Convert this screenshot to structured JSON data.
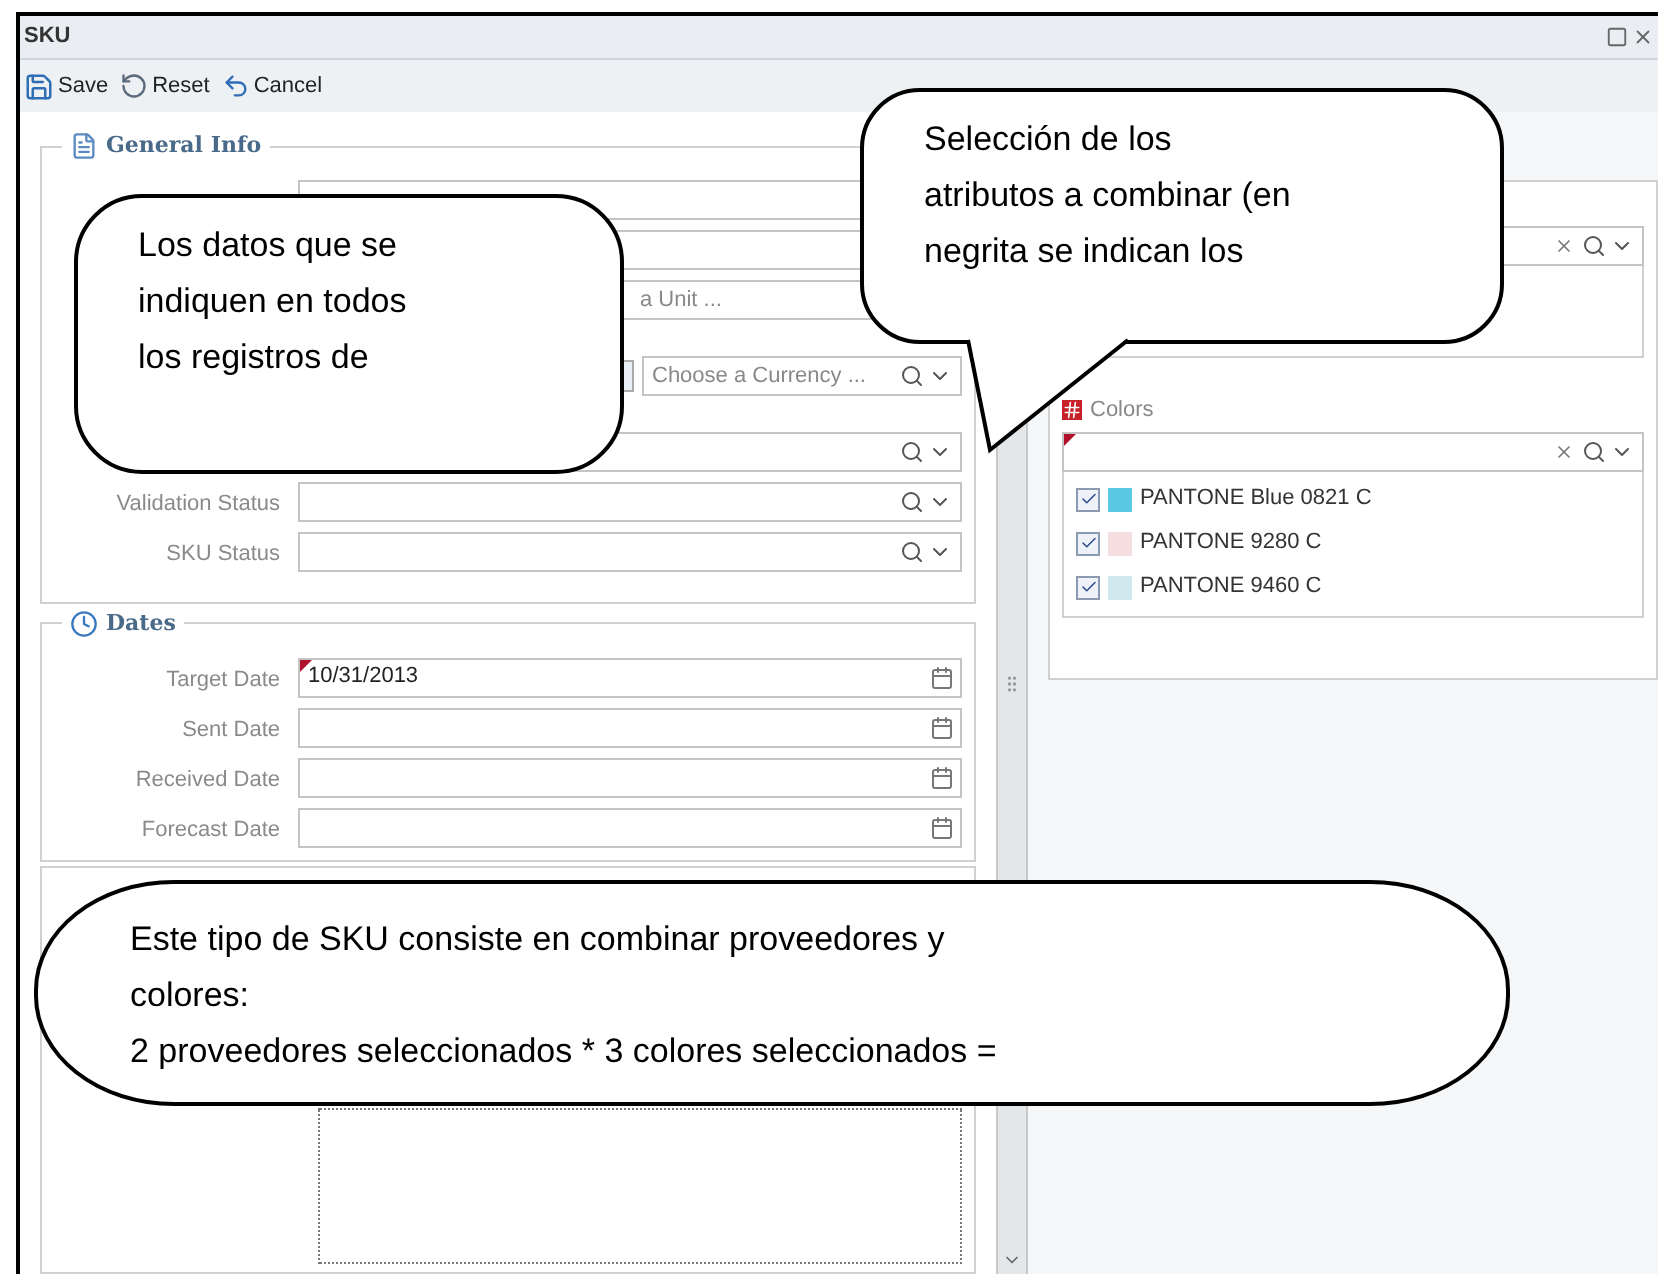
{
  "window": {
    "title": "SKU"
  },
  "toolbar": [
    {
      "kind": "save",
      "label": "Save"
    },
    {
      "kind": "reset",
      "label": "Reset"
    },
    {
      "kind": "cancel",
      "label": "Cancel"
    }
  ],
  "general_info": {
    "title": "General Info",
    "fields": [
      {
        "kind": "text"
      },
      {
        "kind": "text"
      },
      {
        "kind": "text",
        "placeholder": "a Unit ..."
      },
      {
        "kind": "currency",
        "placeholder": "Choose a Currency ..."
      },
      {
        "kind": "combo"
      },
      {
        "kind": "combo",
        "label": "Validation Status"
      },
      {
        "kind": "combo",
        "label": "SKU Status"
      }
    ]
  },
  "dates": {
    "title": "Dates",
    "fields": [
      {
        "label": "Target Date",
        "value": "10/31/2013",
        "required": true
      },
      {
        "label": "Sent Date",
        "required": false
      },
      {
        "label": "Received Date",
        "required": false
      },
      {
        "label": "Forecast Date",
        "required": false
      }
    ]
  },
  "attributes": {
    "colors": {
      "title": "Colors",
      "required": true,
      "items": [
        {
          "name": "PANTONE Blue 0821 C",
          "color": "#5bc8e3",
          "checked": true
        },
        {
          "name": "PANTONE 9280 C",
          "color": "#f6dde0",
          "checked": true
        },
        {
          "name": "PANTONE 9460 C",
          "color": "#cfe9ee",
          "checked": true
        }
      ]
    }
  },
  "callouts": [
    {
      "text": "Los datos que se\nindiquen en todos\nlos registros de"
    },
    {
      "text": "Selección de los\natributos a combinar (en\nnegrita se indican los"
    },
    {
      "text": "Este tipo de SKU consiste en combinar proveedores y\ncolores:\n2 proveedores seleccionados * 3 colores seleccionados ="
    }
  ]
}
